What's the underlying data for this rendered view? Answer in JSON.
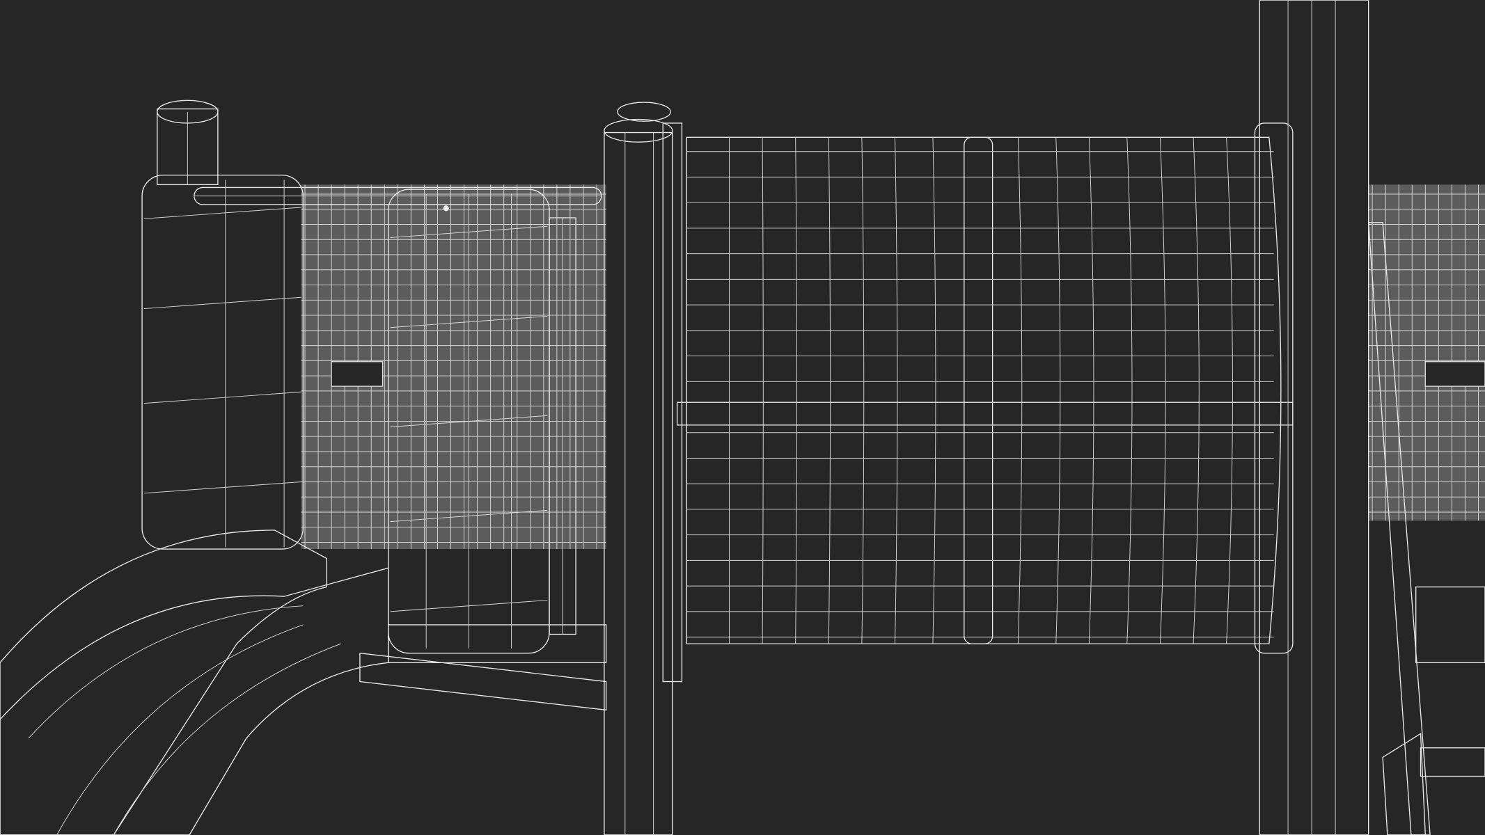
{
  "scene": {
    "subject": "playground-wireframe-render",
    "colors": {
      "background": "#262626",
      "surface": "#6c6c6c",
      "surface_dark": "#5a5a5a",
      "wire": "#e8e8e8"
    }
  }
}
